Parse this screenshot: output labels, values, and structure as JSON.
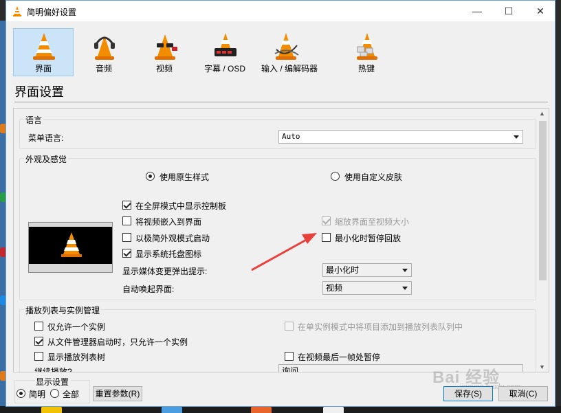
{
  "window": {
    "title": "简明偏好设置",
    "min_icon": "minimize-icon",
    "max_icon": "maximize-icon",
    "close_icon": "close-icon"
  },
  "categories": [
    {
      "label": "界面",
      "icon": "vlc-cone-icon",
      "active": true
    },
    {
      "label": "音频",
      "icon": "headphones-cone-icon",
      "active": false
    },
    {
      "label": "视频",
      "icon": "glasses-cone-icon",
      "active": false
    },
    {
      "label": "字幕 / OSD",
      "icon": "subtitle-cone-icon",
      "active": false
    },
    {
      "label": "输入 / 编解码器",
      "icon": "cable-cone-icon",
      "active": false
    },
    {
      "label": "热键",
      "icon": "keyboard-cone-icon",
      "active": false
    }
  ],
  "section_title": "界面设置",
  "language_group": {
    "title": "语言",
    "menu_language_label": "菜单语言:",
    "menu_language_value": "Auto"
  },
  "look_group": {
    "title": "外观及感觉",
    "radio_native": "使用原生样式",
    "radio_custom": "使用自定义皮肤",
    "cb_fullscreen_controller": "在全屏模式中显示控制板",
    "cb_embed_video": "将视频嵌入到界面",
    "cb_minimal_mode": "以极简外观模式启动",
    "cb_systray": "显示系统托盘图标",
    "cb_resize_interface": "缩放界面至视频大小",
    "cb_pause_minimized": "最小化时暂停回放",
    "popup_label": "显示媒体变更弹出提示:",
    "popup_value": "最小化时",
    "raise_label": "自动唤起界面:",
    "raise_value": "视频"
  },
  "playlist_group": {
    "title": "播放列表与实例管理",
    "cb_one_instance": "仅允许一个实例",
    "cb_enqueue": "在单实例模式中将项目添加到播放列表队列中",
    "cb_one_instance_file": "从文件管理器启动时，只允许一个实例",
    "cb_show_playlist_tree": "显示播放列表树",
    "cb_pause_last_frame": "在视频最后一帧处暂停",
    "partial_label": "继续播放?",
    "partial_value": "询问"
  },
  "footer": {
    "show_settings_title": "显示设置",
    "radio_simple": "简明",
    "radio_all": "全部",
    "reset_button": "重置参数(R)",
    "save_button": "保存(S)",
    "cancel_button": "取消(C)"
  },
  "watermark": {
    "text": "Bai 经验",
    "sub": "jingyan.baidu.com"
  },
  "colors": {
    "active_tab": "#cce4f7",
    "arrow": "#e8413c",
    "cone_orange": "#f28c00"
  }
}
